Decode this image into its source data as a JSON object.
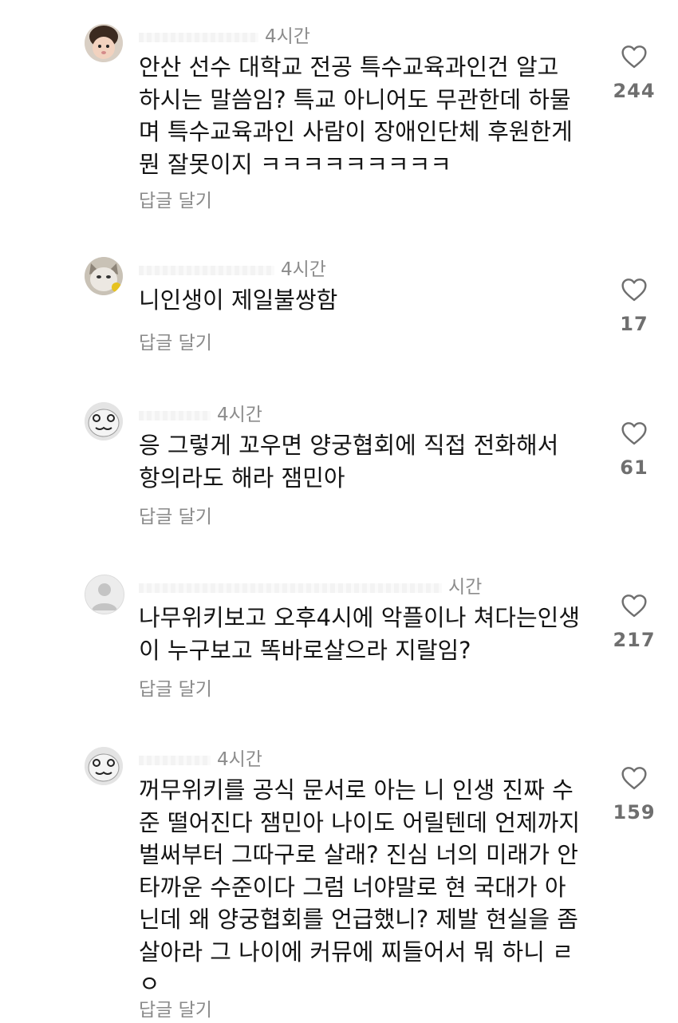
{
  "comments": [
    {
      "time": "4시간",
      "text": "안산 선수 대학교 전공 특수교육과인건 알고\n하시는 말씀임? 특교 아니어도 무관한데 하물\n며 특수교육과인 사람이 장애인단체 후원한게\n뭔 잘못이지 ㅋㅋㅋㅋㅋㅋㅋㅋㅋ",
      "reply_label": "답글 달기",
      "likes": "244",
      "avatar_icon": "child-avatar"
    },
    {
      "time": "4시간",
      "text": "니인생이 제일불쌍함",
      "reply_label": "답글 달기",
      "likes": "17",
      "avatar_icon": "cat-avatar"
    },
    {
      "time": "4시간",
      "text": "응 그렇게 꼬우면 양궁협회에 직접 전화해서\n항의라도 해라 잼민아",
      "reply_label": "답글 달기",
      "likes": "61",
      "avatar_icon": "face-doodle-avatar"
    },
    {
      "time": "시간",
      "text": "나무위키보고 오후4시에 악플이나 쳐다는인생\n이 누구보고 똑바로살으라 지랄임?",
      "reply_label": "답글 달기",
      "likes": "217",
      "avatar_icon": "default-person-avatar"
    },
    {
      "time": "4시간",
      "text": "꺼무위키를 공식 문서로 아는 니 인생 진짜 수\n준 떨어진다 잼민아 나이도 어릴텐데 언제까지\n벌써부터 그따구로 살래? 진심 너의 미래가 안\n타까운 수준이다 그럼 너야말로 현 국대가 아\n닌데 왜 양궁협회를 언급했니? 제발 현실을 좀\n살아라 그 나이에 커뮤에 찌들어서 뭐 하니 ㄹ\nㅇ",
      "reply_label": "답글 달기",
      "likes": "159",
      "avatar_icon": "face-doodle-avatar"
    }
  ],
  "colors": {
    "text": "#141414",
    "secondary": "#8c8c8c",
    "heart_outline": "#6f6f6f"
  },
  "icons": {
    "like": "heart-outline-icon"
  }
}
